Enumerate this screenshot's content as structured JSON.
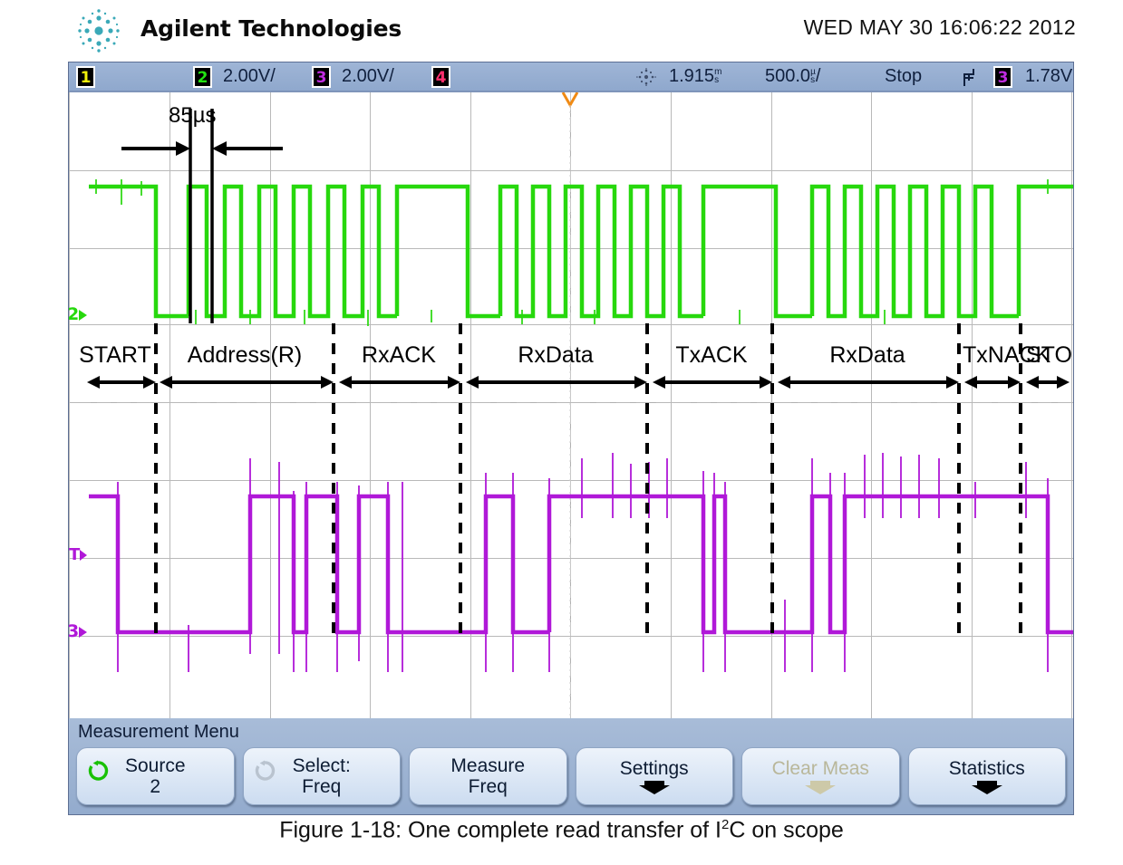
{
  "header": {
    "brand": "Agilent Technologies",
    "datetime": "WED MAY 30 16:06:22 2012",
    "logo_icon": "agilent-starburst-icon"
  },
  "statusbar": {
    "ch1": {
      "badge": "1",
      "scale": "",
      "color": "#f2f20a"
    },
    "ch2": {
      "badge": "2",
      "scale": "2.00V/",
      "color": "#22e312"
    },
    "ch3": {
      "badge": "3",
      "scale": "2.00V/",
      "color": "#c02ce0"
    },
    "ch4": {
      "badge": "4",
      "scale": "",
      "color": "#ff2f6e"
    },
    "acq_icon": "burst-acquisition-icon",
    "delay": "1.915",
    "delay_unit_top": "m",
    "delay_unit_bottom": "s",
    "timebase": "500.0",
    "timebase_unit_top": "µ",
    "timebase_unit_bottom": "s",
    "timebase_suffix": "/",
    "run_state": "Stop",
    "trigger_slope_icon": "rising-edge-icon",
    "trigger_source_badge": "3",
    "trigger_level": "1.78V"
  },
  "plot": {
    "annotation": {
      "label": "85µs",
      "marker_icon": "cursor-span-arrows-icon"
    },
    "trigger_position_icon": "trigger-position-marker-icon",
    "ch2_ground_marker": "2",
    "ch3_ground_marker": "3",
    "trigger_level_marker": "T",
    "protocol_phases": [
      {
        "label": "START",
        "start_pct": 0.0,
        "end_pct": 6.0
      },
      {
        "label": "Address(R)",
        "start_pct": 6.0,
        "end_pct": 24.7
      },
      {
        "label": "RxACK",
        "start_pct": 24.7,
        "end_pct": 37.2
      },
      {
        "label": "RxData",
        "start_pct": 37.2,
        "end_pct": 55.8
      },
      {
        "label": "TxACK",
        "start_pct": 55.8,
        "end_pct": 68.4
      },
      {
        "label": "RxData",
        "start_pct": 68.4,
        "end_pct": 87.0
      },
      {
        "label": "TxNACK",
        "start_pct": 87.0,
        "end_pct": 93.2
      },
      {
        "label": "STOP",
        "start_pct": 93.2,
        "end_pct": 100.0
      }
    ],
    "colors": {
      "ch2_green": "#27d80d",
      "ch3_purple": "#b018d8",
      "grid": "#b9b9b9",
      "background": "#ffffff"
    }
  },
  "menu": {
    "title": "Measurement Menu",
    "softkeys": [
      {
        "line1": "Source",
        "line2": "2",
        "icon": "rotary-knob-icon",
        "icon_state": "active",
        "enabled": true
      },
      {
        "line1": "Select:",
        "line2": "Freq",
        "icon": "rotary-knob-icon",
        "icon_state": "inactive",
        "enabled": true
      },
      {
        "line1": "Measure",
        "line2": "Freq",
        "icon": "",
        "icon_state": "",
        "enabled": true
      },
      {
        "line1": "Settings",
        "line2": "",
        "icon": "down-arrow-icon",
        "icon_state": "active",
        "enabled": true
      },
      {
        "line1": "Clear Meas",
        "line2": "",
        "icon": "down-arrow-icon",
        "icon_state": "disabled",
        "enabled": false
      },
      {
        "line1": "Statistics",
        "line2": "",
        "icon": "down-arrow-icon",
        "icon_state": "active",
        "enabled": true
      }
    ]
  },
  "caption": {
    "prefix": "Figure 1-18: One complete read transfer of I",
    "sup": "2",
    "suffix": "C on scope"
  }
}
